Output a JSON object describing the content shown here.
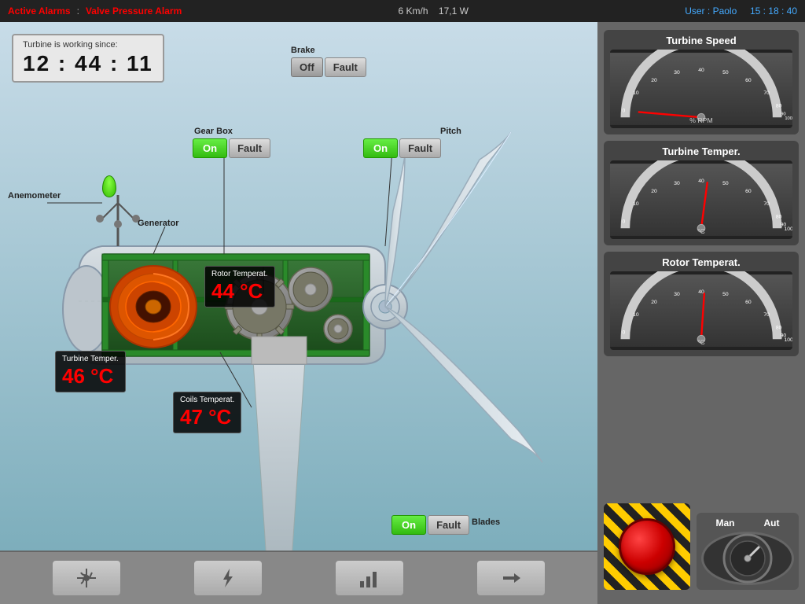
{
  "top_bar": {
    "alarm1": "Active Alarms",
    "separator": ":",
    "alarm2": "Valve Pressure Alarm",
    "speed": "6 Km/h",
    "power": "17,1 W",
    "user_label": "User :",
    "user_name": "Paolo",
    "time": "15 : 18 : 40"
  },
  "working_since": {
    "label": "Turbine is working since:",
    "time": "12 : 44 : 11"
  },
  "controls": {
    "brake": {
      "label": "Brake",
      "off_label": "Off",
      "fault_label": "Fault"
    },
    "gearbox": {
      "label": "Gear Box",
      "on_label": "On",
      "fault_label": "Fault"
    },
    "pitch": {
      "label": "Pitch",
      "on_label": "On",
      "fault_label": "Fault"
    },
    "blades": {
      "label": "Blades",
      "on_label": "On",
      "fault_label": "Fault"
    }
  },
  "temperatures": {
    "rotor": {
      "label": "Rotor Temperat.",
      "value": "44 °C"
    },
    "turbine": {
      "label": "Turbine Temper.",
      "value": "46 °C"
    },
    "coils": {
      "label": "Coils Temperat.",
      "value": "47 °C"
    }
  },
  "labels": {
    "anemometer": "Anemometer",
    "generator": "Generator"
  },
  "gauges": {
    "speed": {
      "title": "Turbine Speed",
      "unit": "% RPM",
      "value": 5,
      "min": 0,
      "max": 100,
      "marks": [
        "0",
        "10",
        "20",
        "30",
        "40",
        "50",
        "60",
        "70",
        "80",
        "90",
        "100"
      ]
    },
    "temper": {
      "title": "Turbine Temper.",
      "unit": "°C",
      "value": 46,
      "min": 0,
      "max": 100,
      "marks": [
        "0",
        "10",
        "20",
        "30",
        "40",
        "50",
        "60",
        "70",
        "80",
        "90",
        "100"
      ]
    },
    "rotor": {
      "title": "Rotor Temperat.",
      "unit": "°C",
      "value": 44,
      "min": 0,
      "max": 100,
      "marks": [
        "0",
        "10",
        "20",
        "30",
        "40",
        "50",
        "60",
        "70",
        "80",
        "90",
        "100"
      ]
    }
  },
  "man_aut": {
    "man_label": "Man",
    "aut_label": "Aut"
  },
  "toolbar": {
    "btn1_icon": "●",
    "btn2_icon": "⚡",
    "btn3_icon": "▦",
    "btn4_icon": "→"
  }
}
